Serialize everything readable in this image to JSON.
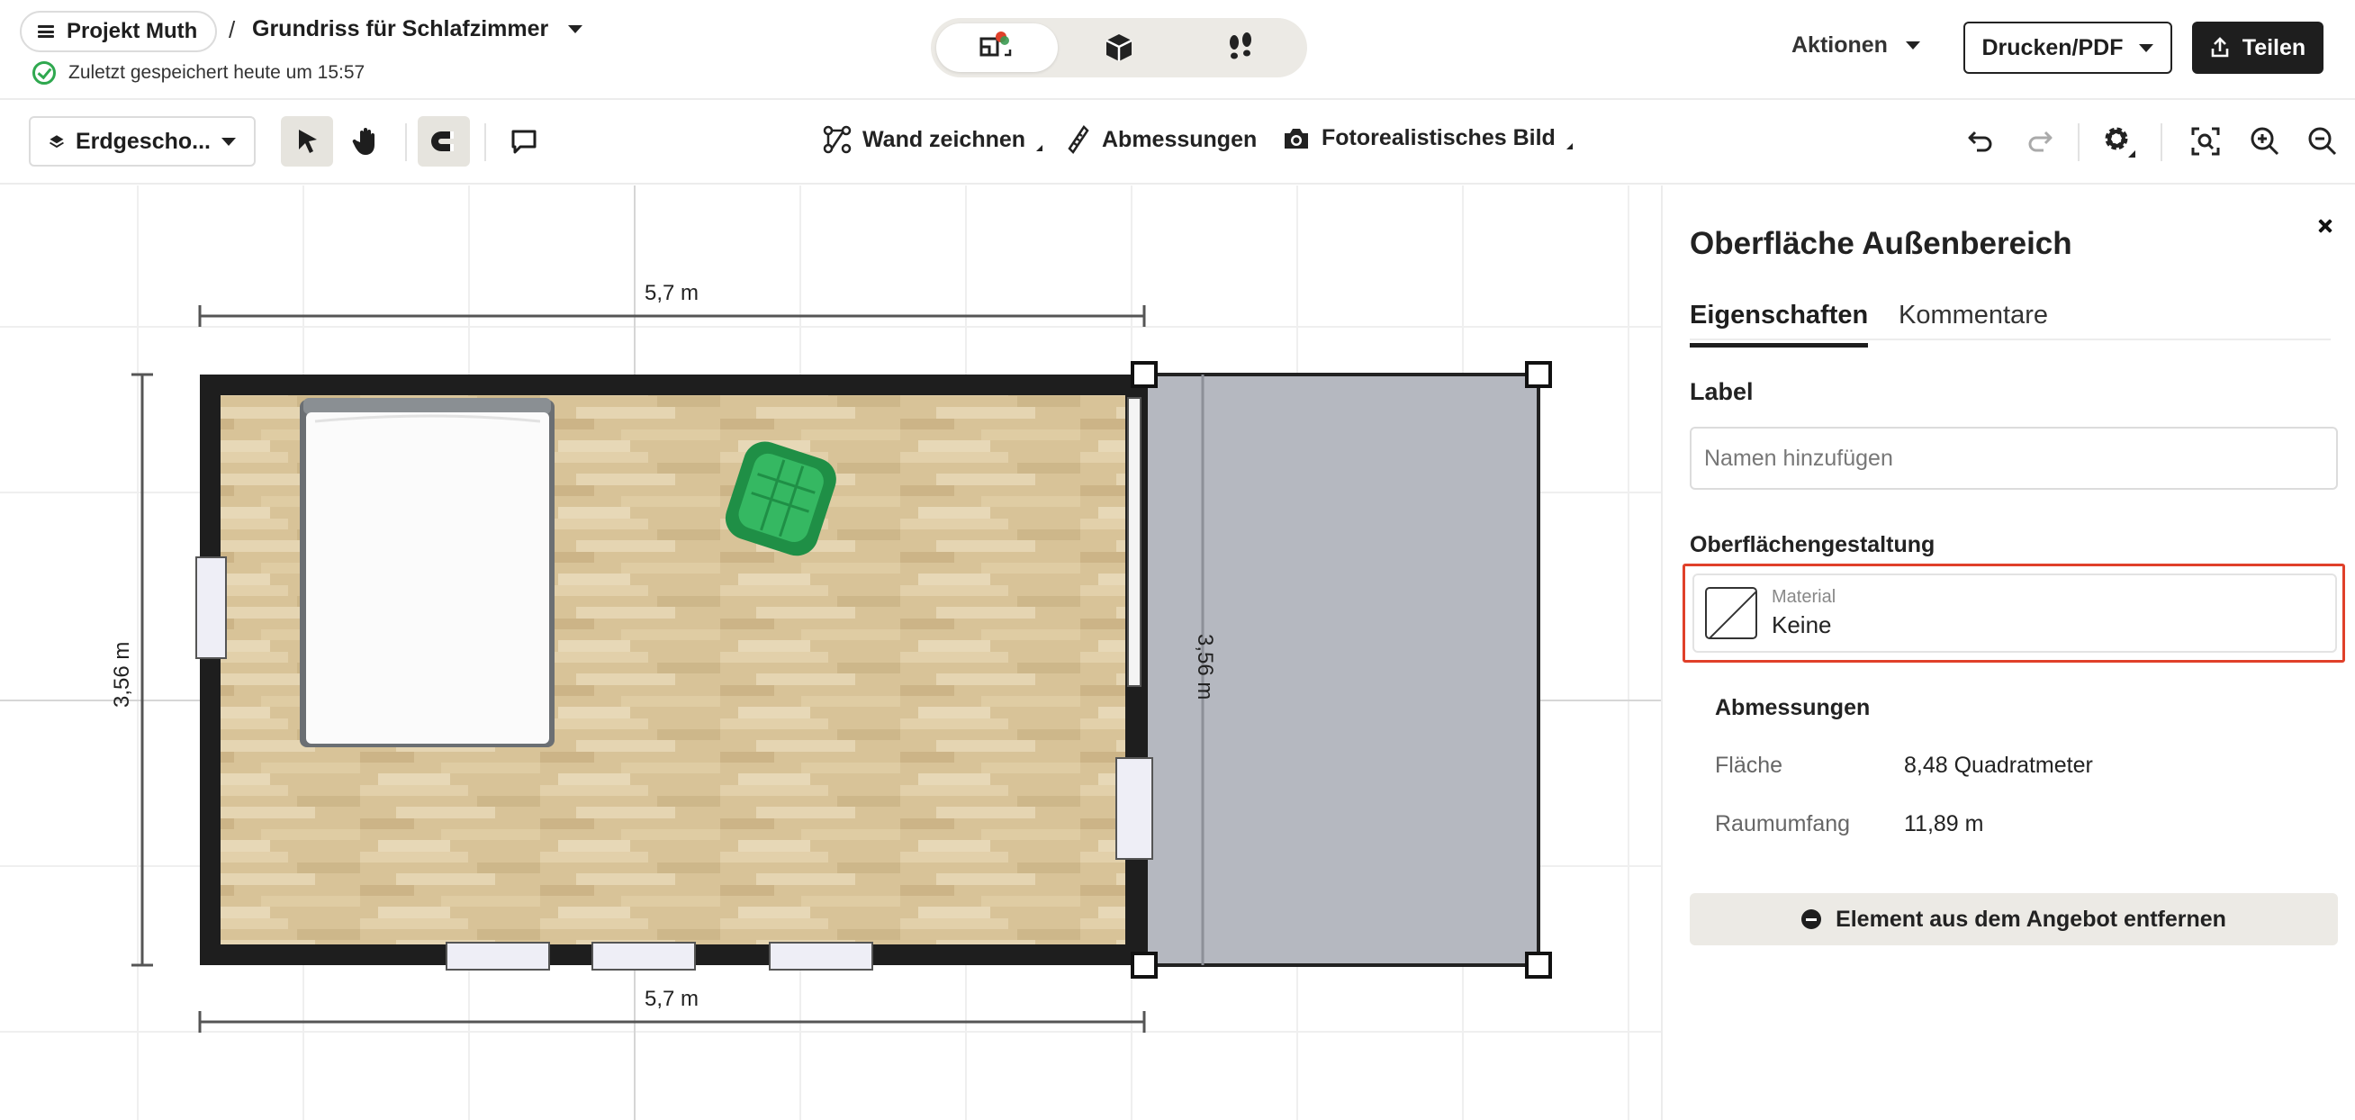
{
  "header": {
    "project_label": "Projekt Muth",
    "separator": "/",
    "plan_title": "Grundriss für Schlafzimmer",
    "saved_status": "Zuletzt gespeichert heute um 15:57",
    "view_modes": [
      "2D-Plan",
      "3D-Ansicht",
      "Begehung"
    ],
    "active_view": "2D-Plan",
    "actions_label": "Aktionen",
    "print_label": "Drucken/PDF",
    "share_label": "Teilen"
  },
  "toolbar": {
    "floor": "Erdgescho...",
    "draw_wall_label": "Wand zeichnen",
    "dimensions_label": "Abmessungen",
    "photo_label": "Fotorealistisches Bild"
  },
  "canvas": {
    "dim_top": "5,7 m",
    "dim_bottom": "5,7 m",
    "dim_left": "3,56 m",
    "dim_inner": "3,56 m"
  },
  "panel": {
    "title": "Oberfläche Außenbereich",
    "tabs": [
      "Eigenschaften",
      "Kommentare"
    ],
    "active_tab": "Eigenschaften",
    "label_heading": "Label",
    "name_placeholder": "Namen hinzufügen",
    "surface_heading": "Oberflächengestaltung",
    "material_label": "Material",
    "material_value": "Keine",
    "dimensions_heading": "Abmessungen",
    "area_label": "Fläche",
    "area_value": "8,48 Quadratmeter",
    "perimeter_label": "Raumumfang",
    "perimeter_value": "11,89 m",
    "remove_label": "Element aus dem Angebot entfernen"
  },
  "colors": {
    "accent_dark": "#1e1e1e",
    "highlight_border": "#e0402a",
    "saved_ok": "#2fa84f",
    "floor_wood": "#dcc8a0",
    "outdoor_area": "#b4b7bf",
    "chair_green": "#2aa855"
  }
}
